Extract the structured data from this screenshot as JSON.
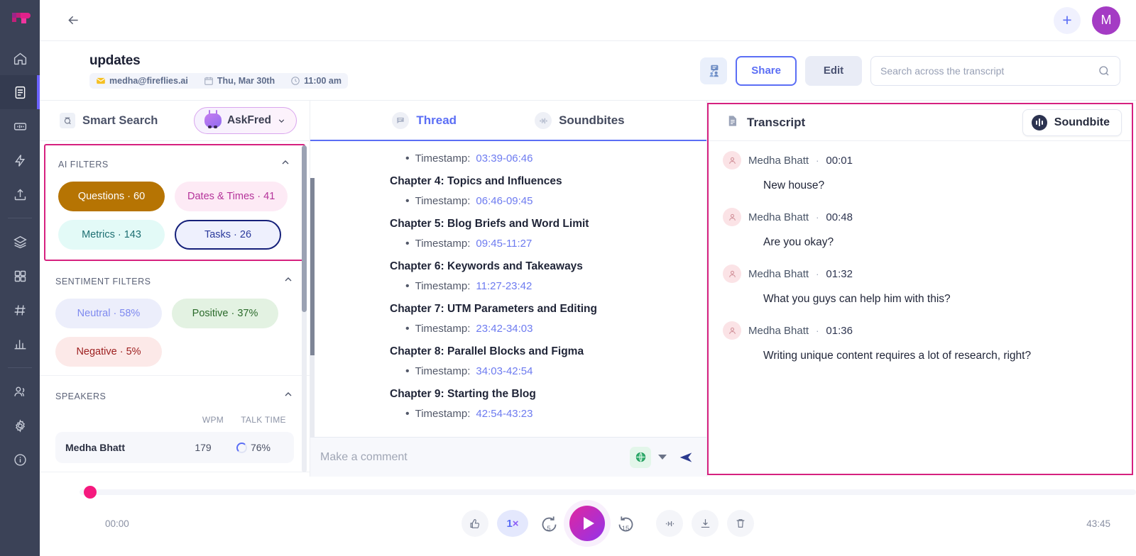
{
  "rail": {
    "logo": "fireflies-logo",
    "items": [
      {
        "name": "home-icon",
        "active": false
      },
      {
        "name": "document-icon",
        "active": true
      },
      {
        "name": "soundwave-card-icon",
        "active": false
      },
      {
        "name": "lightning-icon",
        "active": false
      },
      {
        "name": "upload-icon",
        "active": false
      },
      {
        "name": "layers-icon",
        "active": false
      },
      {
        "name": "apps-grid-icon",
        "active": false
      },
      {
        "name": "hash-icon",
        "active": false
      },
      {
        "name": "analytics-icon",
        "active": false
      },
      {
        "name": "people-icon",
        "active": false
      },
      {
        "name": "gear-icon",
        "active": false
      },
      {
        "name": "info-icon",
        "active": false
      }
    ]
  },
  "topbar": {
    "back_icon": "arrow-left-icon",
    "plus_label": "+",
    "avatar_initial": "M",
    "avatar_color": "#a43bc4"
  },
  "meeting": {
    "title": "updates",
    "email": "medha@fireflies.ai",
    "date": "Thu, Mar 30th",
    "time": "11:00 am",
    "attendees_icon": "attendees-icon",
    "share_label": "Share",
    "edit_label": "Edit"
  },
  "search": {
    "placeholder": "Search across the transcript",
    "value": "",
    "icon": "search-icon"
  },
  "sidebar": {
    "smart_search_label": "Smart Search",
    "askfred_label": "AskFred",
    "ai_filters": {
      "title": "AI FILTERS",
      "chips": [
        {
          "label": "Questions · 60",
          "style": "questions"
        },
        {
          "label": "Dates & Times · 41",
          "style": "dates"
        },
        {
          "label": "Metrics · 143",
          "style": "metrics"
        },
        {
          "label": "Tasks · 26",
          "style": "tasks"
        }
      ]
    },
    "sentiment_filters": {
      "title": "SENTIMENT FILTERS",
      "chips": [
        {
          "label": "Neutral · 58%",
          "style": "neutral"
        },
        {
          "label": "Positive · 37%",
          "style": "positive"
        },
        {
          "label": "Negative · 5%",
          "style": "negative"
        }
      ]
    },
    "speakers": {
      "title": "SPEAKERS",
      "col_wpm": "WPM",
      "col_talktime": "TALK TIME",
      "rows": [
        {
          "name": "Medha Bhatt",
          "wpm": "179",
          "talk_time": "76%"
        }
      ]
    }
  },
  "thread": {
    "tabs": [
      {
        "label": "Thread",
        "icon": "thread-icon",
        "active": true
      },
      {
        "label": "Soundbites",
        "icon": "soundwave-icon",
        "active": false
      }
    ],
    "timestamp_prefix": "Timestamp:",
    "partial_top_timestamp": "03:39-06:46",
    "chapters": [
      {
        "title": "Chapter 4: Topics and Influences",
        "timestamp": "06:46-09:45"
      },
      {
        "title": "Chapter 5: Blog Briefs and Word Limit",
        "timestamp": "09:45-11:27"
      },
      {
        "title": "Chapter 6: Keywords and Takeaways",
        "timestamp": "11:27-23:42"
      },
      {
        "title": "Chapter 7: UTM Parameters and Editing",
        "timestamp": "23:42-34:03"
      },
      {
        "title": "Chapter 8: Parallel Blocks and Figma",
        "timestamp": "34:03-42:54"
      },
      {
        "title": "Chapter 9: Starting the Blog",
        "timestamp": "42:54-43:23"
      }
    ],
    "comment": {
      "placeholder": "Make a comment",
      "value": "",
      "globe_icon": "globe-icon",
      "caret_icon": "chevron-down-icon",
      "send_icon": "send-icon"
    }
  },
  "transcript": {
    "title": "Transcript",
    "title_icon": "document-icon",
    "soundbite_label": "Soundbite",
    "soundbite_icon": "soundwave-icon",
    "entries": [
      {
        "speaker": "Medha Bhatt",
        "time": "00:01",
        "text": "New house?"
      },
      {
        "speaker": "Medha Bhatt",
        "time": "00:48",
        "text": "Are you okay?"
      },
      {
        "speaker": "Medha Bhatt",
        "time": "01:32",
        "text": "What you guys can help him with this?"
      },
      {
        "speaker": "Medha Bhatt",
        "time": "01:36",
        "text": "Writing unique content requires a lot of research, right?"
      }
    ]
  },
  "player": {
    "current_time": "00:00",
    "total_time": "43:45",
    "speed": "1",
    "speed_x": "×",
    "rewind_seconds": "5",
    "forward_seconds": "15",
    "buttons": [
      {
        "name": "thumbs-up-icon"
      },
      {
        "name": "playback-speed-button"
      },
      {
        "name": "rewind-5-icon"
      },
      {
        "name": "play-icon"
      },
      {
        "name": "forward-15-icon"
      },
      {
        "name": "soundwave-icon"
      },
      {
        "name": "download-icon"
      },
      {
        "name": "trash-icon"
      }
    ]
  },
  "colors": {
    "accent": "#5b6ef5",
    "highlight_border": "#d6217f",
    "rail_bg": "#3b4257",
    "seek_knob": "#f5197e"
  }
}
